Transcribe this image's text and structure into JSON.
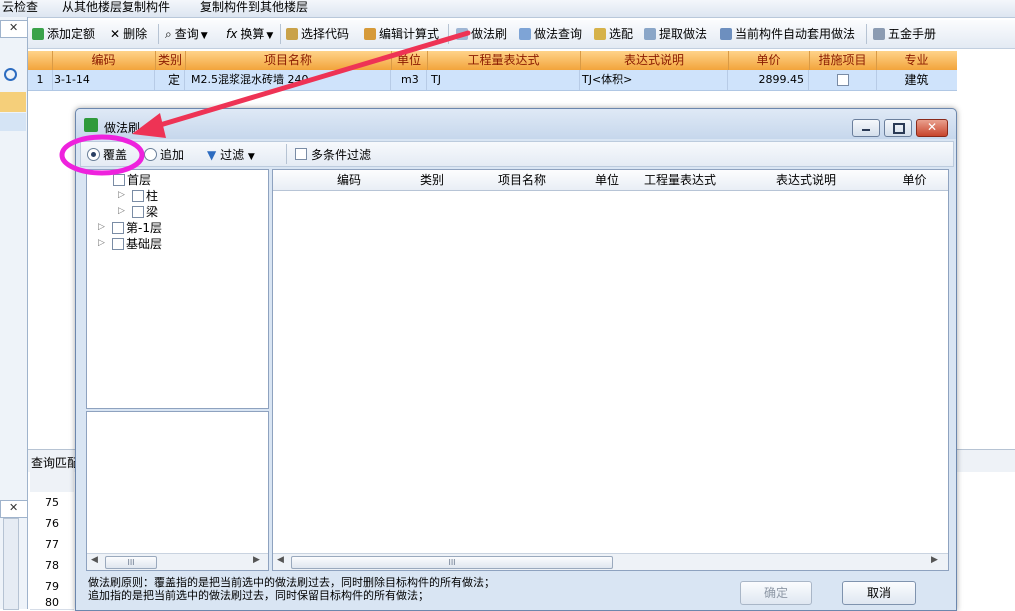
{
  "topstrip": {
    "item1": "云检查",
    "item2": "从其他楼层复制构件",
    "item3": "复制构件到其他楼层"
  },
  "toolbar": {
    "add_quota": "添加定额",
    "delete": "删除",
    "query": "查询",
    "convert": "换算",
    "select_code": "选择代码",
    "edit_formula": "编辑计算式",
    "method_brush": "做法刷",
    "method_query": "做法查询",
    "select_match": "选配",
    "extract_method": "提取做法",
    "auto_apply": "当前构件自动套用做法",
    "hardware_manual": "五金手册"
  },
  "grid": {
    "columns": [
      "编码",
      "类别",
      "项目名称",
      "单位",
      "工程量表达式",
      "表达式说明",
      "单价",
      "措施项目",
      "专业"
    ],
    "rows": [
      {
        "num": "1",
        "code": "3-1-14",
        "type": "定",
        "name": "M2.5混浆混水砖墙 240",
        "unit": "m3",
        "expr": "TJ",
        "desc": "TJ<体积>",
        "price": "2899.45",
        "measure": false,
        "major": "建筑"
      }
    ]
  },
  "lower": {
    "query_label": "查询匹配",
    "row_numbers": [
      "75",
      "76",
      "77",
      "78",
      "79",
      "80"
    ]
  },
  "dialog": {
    "title": "做法刷",
    "options": {
      "cover": "覆盖",
      "append": "追加",
      "filter": "过滤",
      "multi_filter": "多条件过滤"
    },
    "tree": {
      "floor1": "首层",
      "column": "柱",
      "beam": "梁",
      "floor_minus1": "第-1层",
      "foundation": "基础层"
    },
    "table_columns": [
      "编码",
      "类别",
      "项目名称",
      "单位",
      "工程量表达式",
      "表达式说明",
      "单价"
    ],
    "note_line1": "做法刷原则：覆盖指的是把当前选中的做法刷过去，同时删除目标构件的所有做法；",
    "note_line2": "追加指的是把当前选中的做法刷过去，同时保留目标构件的所有做法；",
    "ok_label": "确定",
    "cancel_label": "取消",
    "scroll_mark": "III"
  },
  "colors": {
    "accent_header": "#f2a43c",
    "annotation": "#ee22dd",
    "arrow": "#ee3355"
  }
}
